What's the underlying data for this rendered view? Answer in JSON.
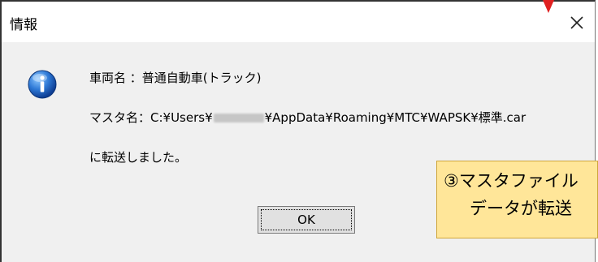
{
  "dialog": {
    "title": "情報",
    "close_icon": "close-icon",
    "info_icon": "information-icon",
    "line1": "車両名 ：普通自動車(トラック)",
    "line2_prefix": "マスタ名：C:¥Users¥",
    "line2_suffix": "¥AppData¥Roaming¥MTC¥WAPSK¥標準.car",
    "line3": "に転送しました。",
    "ok_label": "OK"
  },
  "annotation": {
    "line1": "③マスタファイル",
    "line2": "データが転送",
    "arrow_color": "#e02020",
    "callout_color": "#ffe699"
  }
}
